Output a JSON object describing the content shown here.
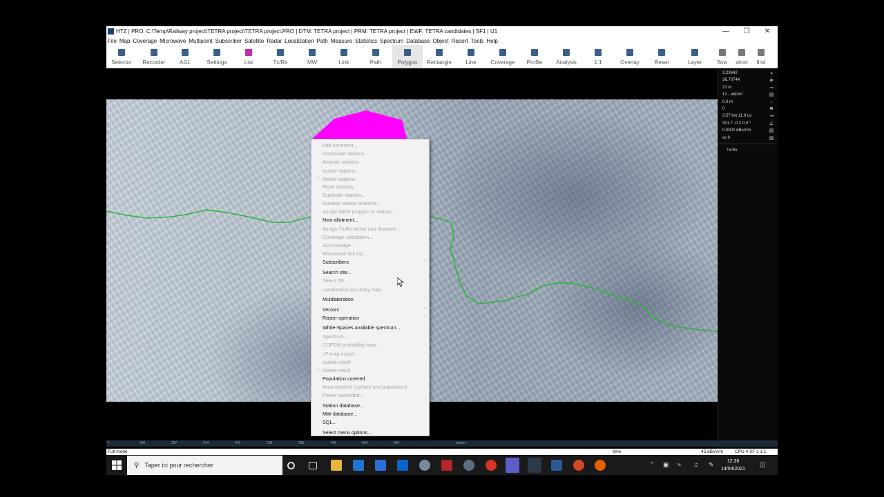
{
  "window": {
    "title": "HTZ | PRO: C:\\Temp\\Railway project\\TETRA project\\TETRA project.PRO | DTM: TETRA project | PRM: TETRA project | EWF: TETRA candidates | SF1 | U1",
    "controls": [
      "—",
      "❒",
      "✕"
    ]
  },
  "menubar": [
    "File",
    "Map",
    "Coverage",
    "Microwave",
    "Multipoint",
    "Subscriber",
    "Satellite",
    "Radar",
    "Localization",
    "Path",
    "Measure",
    "Statistics",
    "Spectrum",
    "Database",
    "Object",
    "Report",
    "Tools",
    "Help"
  ],
  "toolbar": [
    {
      "label": "Selector",
      "icon": "selector-icon"
    },
    {
      "label": "Recorder",
      "icon": "recorder-icon"
    },
    {
      "label": "AGL",
      "icon": "agl-icon"
    },
    {
      "label": "Settings",
      "icon": "settings-icon"
    },
    {
      "label": "List",
      "icon": "list-icon"
    },
    {
      "label": "Tx/Rx",
      "icon": "txrx-icon"
    },
    {
      "label": "MW",
      "icon": "mw-icon"
    },
    {
      "label": "Link",
      "icon": "link-icon"
    },
    {
      "label": "Path",
      "icon": "path-icon"
    },
    {
      "label": "Polygon",
      "icon": "polygon-icon",
      "active": true
    },
    {
      "label": "Rectangle",
      "icon": "rectangle-icon"
    },
    {
      "label": "Line",
      "icon": "line-icon"
    },
    {
      "label": "Coverage",
      "icon": "coverage-icon"
    },
    {
      "label": "Profile",
      "icon": "profile-icon"
    },
    {
      "label": "Analysis",
      "icon": "analysis-icon"
    },
    {
      "label": "1:1",
      "icon": "one-to-one-icon"
    },
    {
      "label": "Overlay",
      "icon": "overlay-icon"
    },
    {
      "label": "Reset",
      "icon": "reset-icon"
    },
    {
      "label": "Layer",
      "icon": "layer-icon"
    },
    {
      "label": "flow",
      "icon": "flow-icon"
    },
    {
      "label": "short",
      "icon": "short-icon"
    },
    {
      "label": "find",
      "icon": "find-icon"
    }
  ],
  "readouts": [
    "3.23642",
    "36.70744",
    "21 m",
    "12 - airport",
    "0.0 m",
    "0",
    "3.57 km 11.9 us",
    "301.7 -0.2 0.0 °",
    "0.0000 dBuV/m",
    "cx 0"
  ],
  "panel": {
    "txrx_label": "Tx/Rx"
  },
  "context_menu": [
    {
      "label": "Add comment...",
      "enabled": false
    },
    {
      "label": "Deactivate stations",
      "enabled": false
    },
    {
      "label": "Activate stations",
      "enabled": false
    },
    {
      "label": "Isolate stations",
      "enabled": false
    },
    {
      "label": "Delete stations",
      "enabled": false,
      "bullet": true
    },
    {
      "label": "Move stations",
      "enabled": false
    },
    {
      "label": "Duplicate stations...",
      "enabled": false
    },
    {
      "label": "Rotation station antenna...",
      "enabled": false
    },
    {
      "label": "Assign latest polygon to station...",
      "enabled": false
    },
    {
      "label": "New allotment...",
      "enabled": true
    },
    {
      "label": "Assign Tx/Rx sector and distance",
      "enabled": false
    },
    {
      "label": "Coverage calculation...",
      "enabled": false
    },
    {
      "label": "3D coverage...",
      "enabled": false
    },
    {
      "label": "Microwave link list...",
      "enabled": false
    },
    {
      "label": "Subscribers",
      "enabled": true,
      "submenu": true
    },
    {
      "label": "Search site...",
      "enabled": true
    },
    {
      "label": "Select DF...",
      "enabled": false
    },
    {
      "label": "Localization accuracy map...",
      "enabled": false
    },
    {
      "label": "Multilateration",
      "enabled": true,
      "submenu": true
    },
    {
      "label": "Vectors",
      "enabled": true,
      "submenu": true
    },
    {
      "label": "Raster operation",
      "enabled": true,
      "submenu": true
    },
    {
      "label": "White-Spaces available spectrum...",
      "enabled": true
    },
    {
      "label": "Spectrum...",
      "enabled": false
    },
    {
      "label": "COFDM probability map...",
      "enabled": false
    },
    {
      "label": "LP map export...",
      "enabled": false
    },
    {
      "label": "Isolate result",
      "enabled": false
    },
    {
      "label": "Delete result",
      "enabled": false,
      "bullet": true
    },
    {
      "label": "Population covered",
      "enabled": true
    },
    {
      "label": "Area covered (surface and population)",
      "enabled": false
    },
    {
      "label": "Power exceeded...",
      "enabled": false
    },
    {
      "label": "Station database...",
      "enabled": true
    },
    {
      "label": "MW database...",
      "enabled": true
    },
    {
      "label": "SQL...",
      "enabled": true
    },
    {
      "label": "Select menu options...",
      "enabled": true
    }
  ],
  "scale_ticks": [
    "-7",
    "100",
    "207",
    "314",
    "421",
    "528",
    "635",
    "742",
    "849",
    "956",
    "meters"
  ],
  "status": {
    "mode": "Full mode",
    "time_label": "time",
    "field": "45 dBuV/m",
    "cpu": "CPU 4  SF 1  1:1"
  },
  "taskbar": {
    "search_placeholder": "Taper ici pour rechercher",
    "time": "12:36",
    "date": "14/04/2021"
  },
  "colors": {
    "polygon": "#ff00ff",
    "path": "#2db53a",
    "accent": "#1f6fd1"
  }
}
